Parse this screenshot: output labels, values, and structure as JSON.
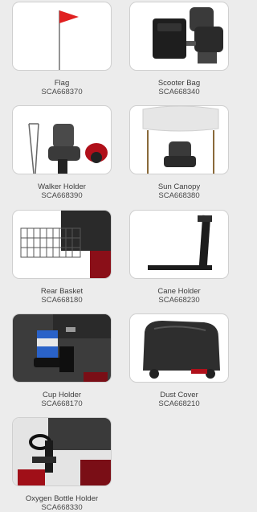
{
  "accessories": [
    {
      "name": "Flag",
      "sku": "SCA668370",
      "icon": "flag-icon"
    },
    {
      "name": "Scooter Bag",
      "sku": "SCA668340",
      "icon": "scooter-bag-icon"
    },
    {
      "name": "Walker Holder",
      "sku": "SCA668390",
      "icon": "walker-holder-icon"
    },
    {
      "name": "Sun Canopy",
      "sku": "SCA668380",
      "icon": "sun-canopy-icon"
    },
    {
      "name": "Rear Basket",
      "sku": "SCA668180",
      "icon": "rear-basket-icon"
    },
    {
      "name": "Cane Holder",
      "sku": "SCA668230",
      "icon": "cane-holder-icon"
    },
    {
      "name": "Cup Holder",
      "sku": "SCA668170",
      "icon": "cup-holder-icon"
    },
    {
      "name": "Dust Cover",
      "sku": "SCA668210",
      "icon": "dust-cover-icon"
    },
    {
      "name": "Oxygen Bottle Holder",
      "sku": "SCA668330",
      "icon": "oxygen-bottle-holder-icon"
    }
  ],
  "colors": {
    "background": "#ececec",
    "card": "#ffffff",
    "flag_red": "#e02020",
    "scooter_red": "#b0101a"
  }
}
